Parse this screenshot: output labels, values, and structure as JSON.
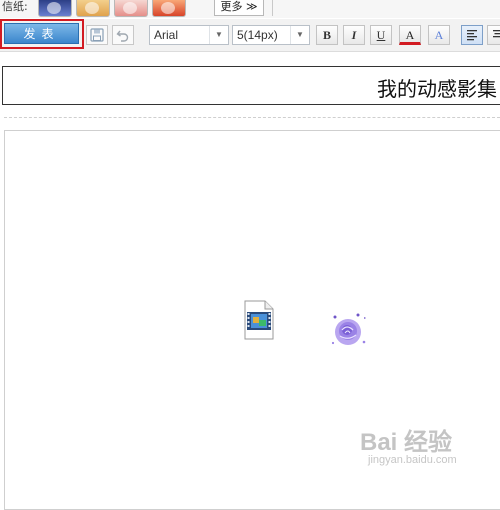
{
  "stationery": {
    "label": "信纸:",
    "more_label": "更多 ≫",
    "thumbnails": [
      "stationery-car",
      "stationery-cartoon-girl",
      "stationery-flowers",
      "stationery-red-bird"
    ]
  },
  "toolbar": {
    "publish_label": "发表",
    "save_icon": "save-icon",
    "undo_icon": "undo-icon",
    "font_family": "Arial",
    "font_size": "5(14px)",
    "bold_label": "B",
    "italic_label": "I",
    "underline_label": "U",
    "font_color_label": "A",
    "highlight_label": "A",
    "align_icon": "align-left-icon"
  },
  "title_field": {
    "value": "我的动感影集"
  },
  "editor": {
    "content_icons": [
      "video-file-icon",
      "purple-rose-image"
    ]
  },
  "watermark": {
    "brand": "Bai 经验",
    "site": "jingyan.baidu.com"
  },
  "colors": {
    "publish_button": "#3b86cc",
    "highlight_outline": "#d21b22",
    "toolbar_bg": "#f2f2f2"
  }
}
